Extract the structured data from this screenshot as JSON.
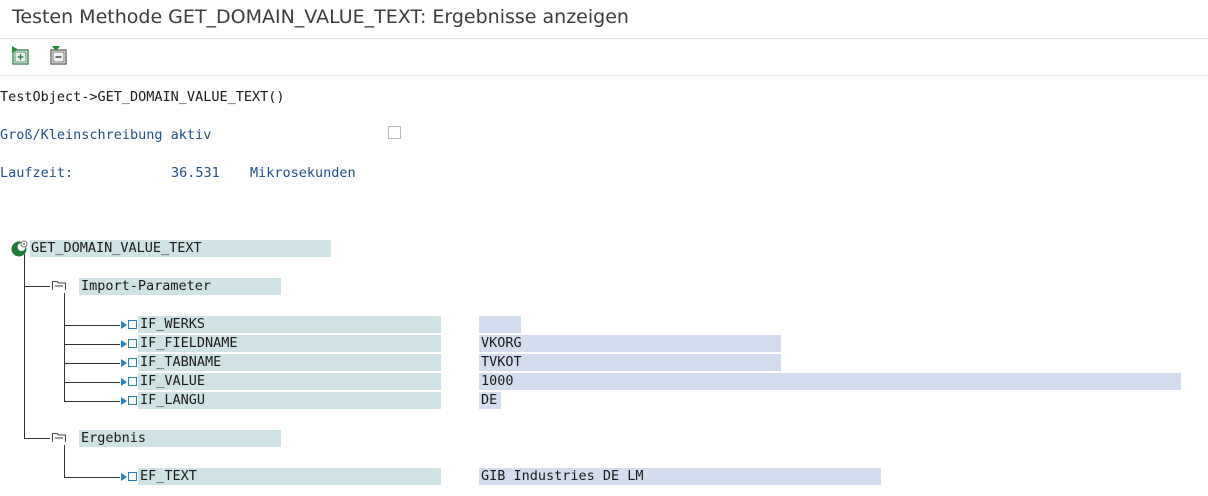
{
  "window": {
    "title": "Testen Methode GET_DOMAIN_VALUE_TEXT: Ergebnisse anzeigen"
  },
  "toolbar": {
    "expand_icon": "expand-all-icon",
    "collapse_icon": "collapse-all-icon"
  },
  "header": {
    "object_call": "TestObject->GET_DOMAIN_VALUE_TEXT()",
    "case_label": "Groß/Kleinschreibung aktiv",
    "runtime_label": "Laufzeit:",
    "runtime_value": "36.531",
    "runtime_unit": "Mikrosekunden"
  },
  "tree": {
    "root": "GET_DOMAIN_VALUE_TEXT",
    "import_group": "Import-Parameter",
    "import_params": [
      {
        "name": "IF_WERKS",
        "value": ""
      },
      {
        "name": "IF_FIELDNAME",
        "value": "VKORG"
      },
      {
        "name": "IF_TABNAME",
        "value": "TVKOT"
      },
      {
        "name": "IF_VALUE",
        "value": "1000"
      },
      {
        "name": "IF_LANGU",
        "value": "DE"
      }
    ],
    "result_group": "Ergebnis",
    "result_params": [
      {
        "name": "EF_TEXT",
        "value": "GIB Industries DE LM"
      }
    ]
  },
  "colors": {
    "name_bg": "#cfe3e4",
    "value_bg": "#d4ddef",
    "label_blue": "#1f4e8c",
    "node_blue": "#2680c2"
  }
}
